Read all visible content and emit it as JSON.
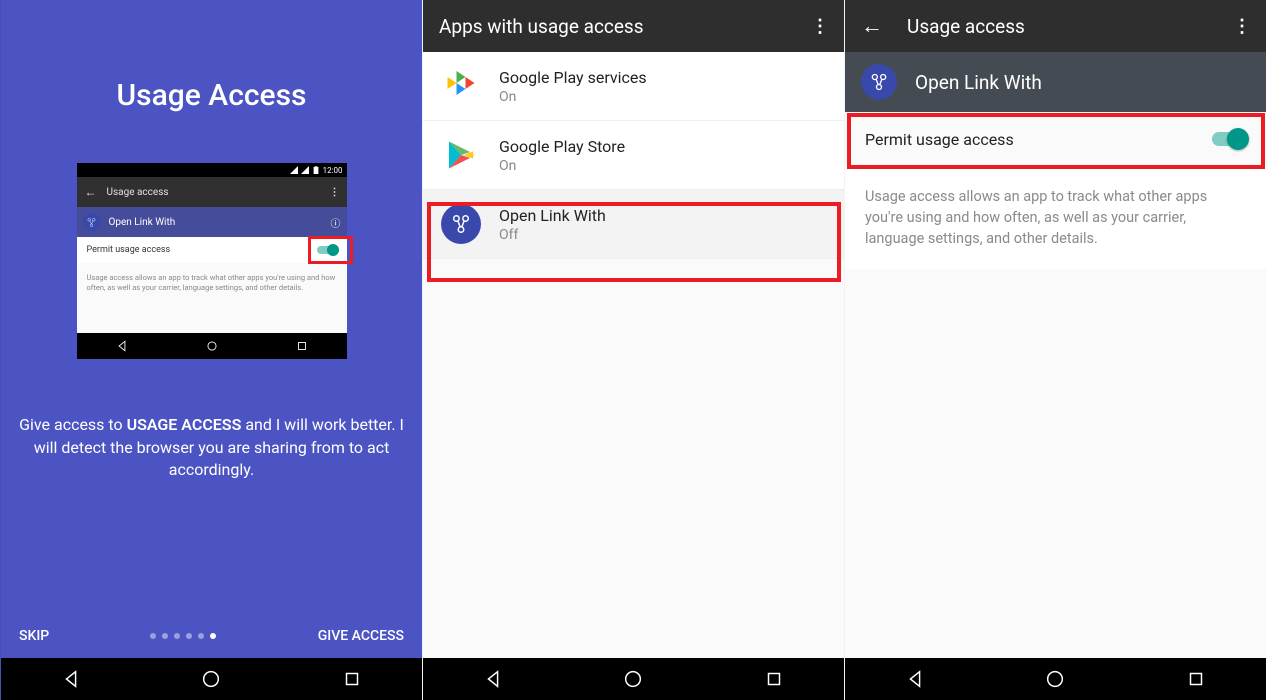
{
  "panel1": {
    "title": "Usage Access",
    "status_time": "12:00",
    "mock_header": "Usage access",
    "mock_app": "Open Link With",
    "mock_permit": "Permit usage access",
    "mock_desc": "Usage access allows an app to track what other apps you're using and how often, as well as your carrier, language settings, and other details.",
    "caption_pre": "Give access to ",
    "caption_bold": "USAGE ACCESS",
    "caption_post": " and I will work better. I will detect the browser you are sharing from to act accordingly.",
    "skip": "SKIP",
    "give": "GIVE ACCESS"
  },
  "panel2": {
    "title": "Apps with usage access",
    "rows": [
      {
        "name": "Google Play services",
        "status": "On"
      },
      {
        "name": "Google Play Store",
        "status": "On"
      },
      {
        "name": "Open Link With",
        "status": "Off"
      }
    ]
  },
  "panel3": {
    "title": "Usage access",
    "app": "Open Link With",
    "permit": "Permit usage access",
    "desc": "Usage access allows an app to track what other apps you're using and how often, as well as your carrier, language settings, and other details."
  }
}
